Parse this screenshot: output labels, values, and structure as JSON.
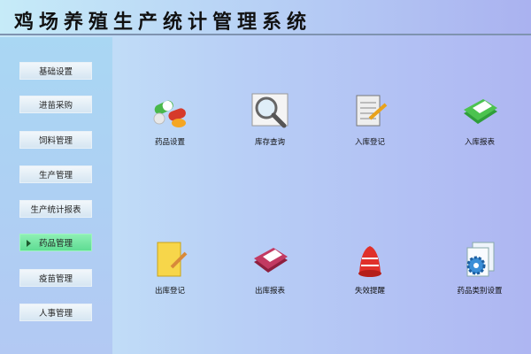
{
  "header": {
    "title": "鸡场养殖生产统计管理系统"
  },
  "sidebar": {
    "items": [
      {
        "label": "基础设置"
      },
      {
        "label": "进苗采购"
      },
      {
        "label": "饲料管理"
      },
      {
        "label": "生产管理"
      },
      {
        "label": "生产统计报表"
      },
      {
        "label": "药品管理",
        "active": true
      },
      {
        "label": "疫苗管理"
      },
      {
        "label": "人事管理"
      }
    ]
  },
  "main": {
    "tiles": [
      {
        "label": "药品设置",
        "icon": "pills-icon"
      },
      {
        "label": "库存查询",
        "icon": "magnifier-icon"
      },
      {
        "label": "入库登记",
        "icon": "notepad-pencil-icon"
      },
      {
        "label": "入库报表",
        "icon": "green-book-icon"
      },
      {
        "label": "出库登记",
        "icon": "yellow-note-icon"
      },
      {
        "label": "出库报表",
        "icon": "red-book-icon"
      },
      {
        "label": "失效提醒",
        "icon": "alarm-bell-icon"
      },
      {
        "label": "药品类别设置",
        "icon": "gear-document-icon"
      }
    ]
  }
}
